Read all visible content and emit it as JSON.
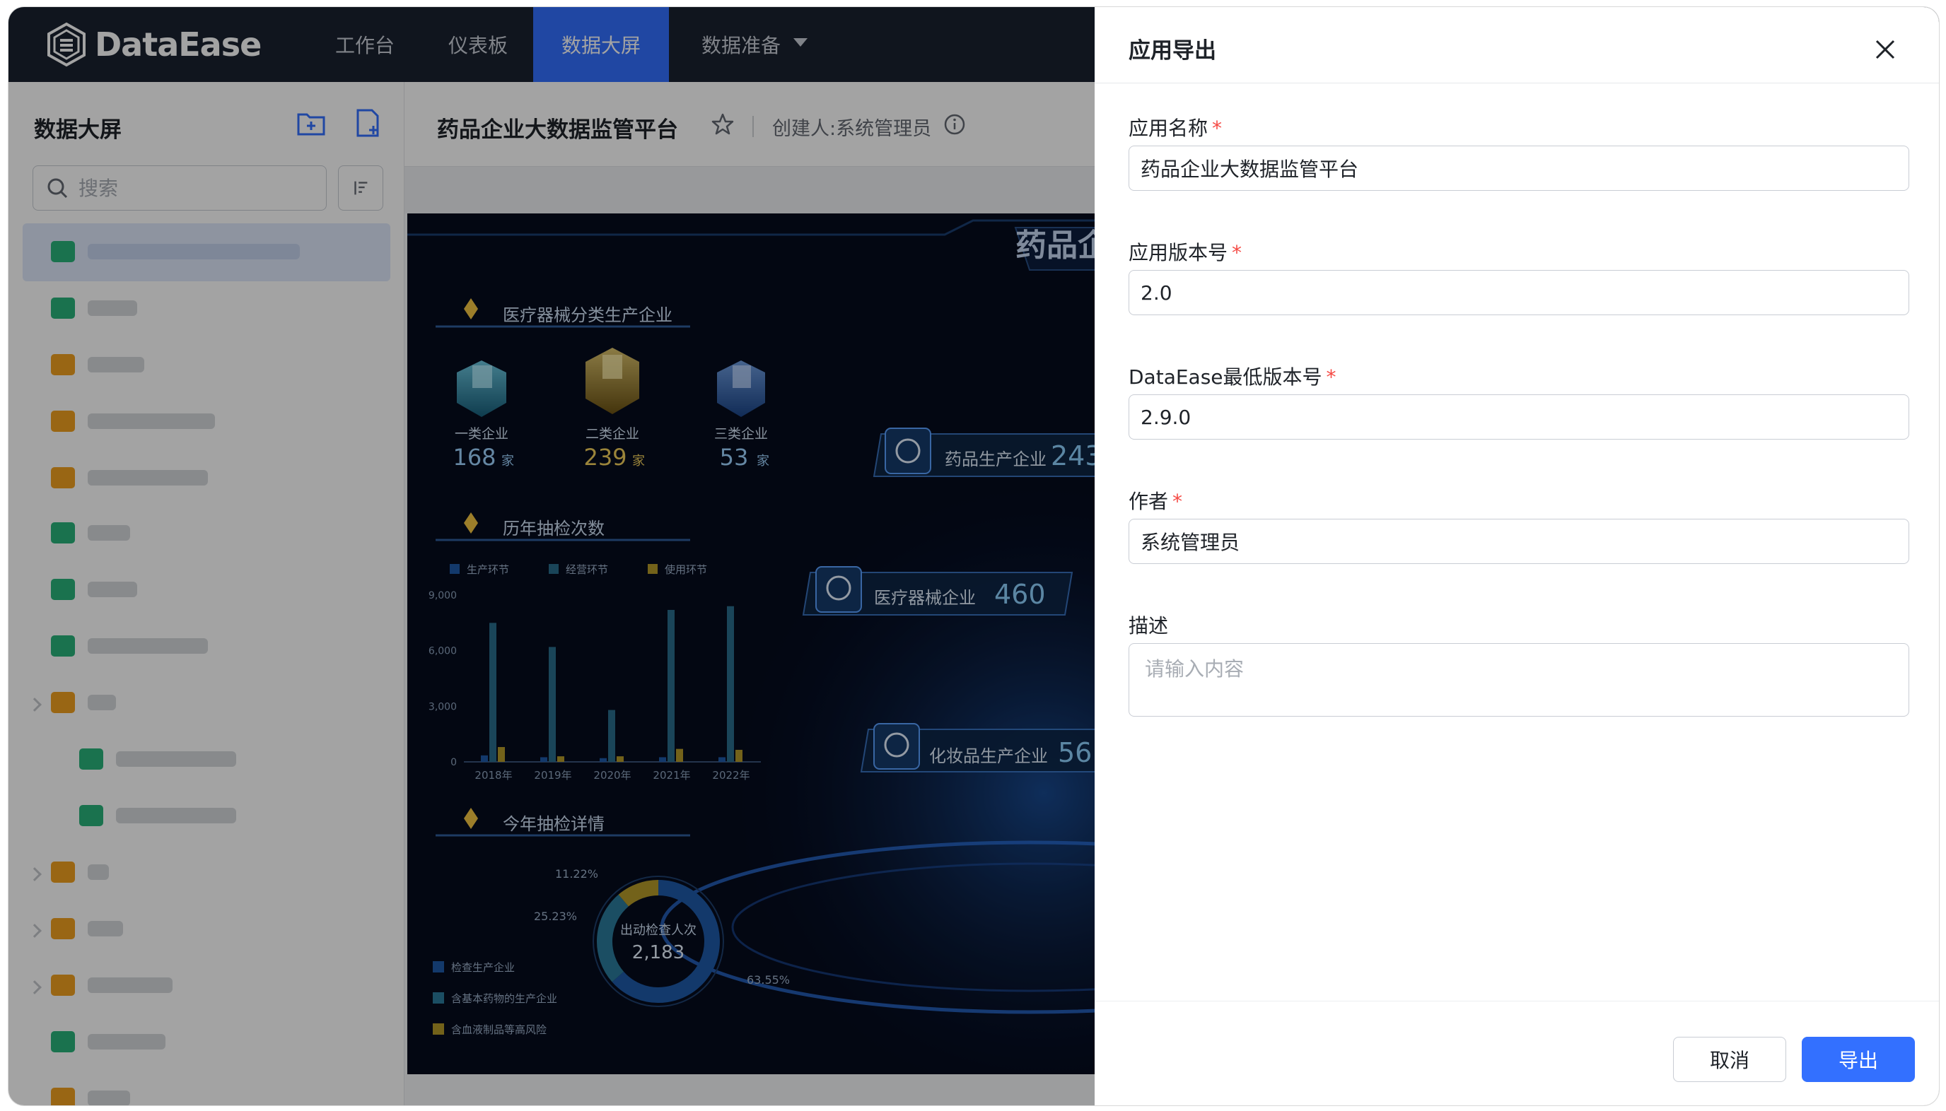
{
  "app": {
    "logo_text": "DataEase",
    "logo_icon": "dataease-hex-logo-icon"
  },
  "nav": {
    "items": [
      {
        "label": "工作台"
      },
      {
        "label": "仪表板"
      },
      {
        "label": "数据大屏",
        "active": true
      },
      {
        "label": "数据准备",
        "has_dropdown": true
      }
    ]
  },
  "sidebar": {
    "title": "数据大屏",
    "icons": [
      "folder-add-icon",
      "file-add-icon"
    ],
    "search": {
      "placeholder": "搜索",
      "value": ""
    },
    "sort_icon": "sort-icon"
  },
  "main": {
    "title": "药品企业大数据监管平台",
    "creator": "创建人:系统管理员"
  },
  "dashboard": {
    "header_partial": "药品企",
    "sections": {
      "device": "医疗器械分类生产企业",
      "inspection_history": "历年抽检次数",
      "this_year": "今年抽检详情"
    },
    "unit": "家",
    "categories": [
      {
        "label": "一类企业",
        "value": "168",
        "color": "#35c8e0"
      },
      {
        "label": "二类企业",
        "value": "239",
        "color": "#e0b93a"
      },
      {
        "label": "三类企业",
        "value": "53",
        "color": "#3b8cff"
      }
    ],
    "stats": [
      {
        "label": "药品生产企业",
        "value": "243"
      },
      {
        "label": "医疗器械企业",
        "value": "460"
      },
      {
        "label": "化妆品生产企业",
        "value": "56"
      }
    ],
    "donut_center_label": "出动检查人次",
    "donut_center_value": "2,183",
    "donut_legend": [
      "检查生产企业",
      "含基本药物的生产企业",
      "含血液制品等高风险"
    ]
  },
  "chart_data": [
    {
      "type": "bar",
      "categories": [
        "2018年",
        "2019年",
        "2020年",
        "2021年",
        "2022年"
      ],
      "series": [
        {
          "name": "生产环节",
          "values": [
            350,
            250,
            200,
            250,
            250
          ]
        },
        {
          "name": "经营环节",
          "values": [
            7500,
            6200,
            2800,
            8200,
            8400
          ]
        },
        {
          "name": "使用环节",
          "values": [
            800,
            300,
            300,
            700,
            650
          ]
        }
      ],
      "y_ticks": [
        "9,000",
        "6,000",
        "3,000",
        "0"
      ],
      "ylim": [
        0,
        9000
      ],
      "colors": [
        "#1e5aa8",
        "#2a6d8c",
        "#b59a2a"
      ]
    },
    {
      "type": "pie",
      "labels": [
        "检查生产企业",
        "含基本药物的生产企业",
        "含血液制品等高风险"
      ],
      "values": [
        63.55,
        25.23,
        11.22
      ],
      "value_labels": [
        "63.55%",
        "25.23%",
        "11.22%"
      ],
      "colors": [
        "#1e5aa8",
        "#2b7a9c",
        "#b59a2a"
      ]
    }
  ],
  "drawer": {
    "title": "应用导出",
    "fields": [
      {
        "label": "应用名称",
        "required": true,
        "value": "药品企业大数据监管平台"
      },
      {
        "label": "应用版本号",
        "required": true,
        "value": "2.0"
      },
      {
        "label": "DataEase最低版本号",
        "required": true,
        "value": "2.9.0"
      },
      {
        "label": "作者",
        "required": true,
        "value": "系统管理员"
      }
    ],
    "description": {
      "label": "描述",
      "placeholder": "请输入内容",
      "value": ""
    },
    "required_mark": "*",
    "cancel_label": "取消",
    "export_label": "导出"
  },
  "colors": {
    "primary": "#3370ff",
    "nav_bg": "#1a2230",
    "required": "#f54a45"
  }
}
